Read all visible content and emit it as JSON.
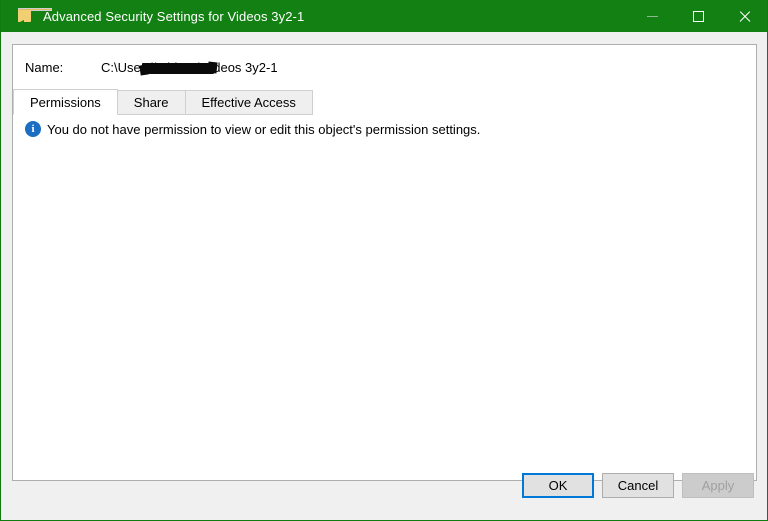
{
  "window": {
    "title": "Advanced Security Settings for Videos 3y2-1",
    "icon": "folder-shield-icon",
    "title_bar_color": "#128012",
    "controls": {
      "minimize": "minimize-icon",
      "maximize": "maximize-icon",
      "close": "close-icon"
    }
  },
  "name_row": {
    "label": "Name:",
    "value_prefix": "C:\\Users\\",
    "value_suffix": "\\Videos\\Videos 3y2-1",
    "redacted": true
  },
  "tabs": [
    {
      "label": "Permissions",
      "active": true
    },
    {
      "label": "Share",
      "active": false
    },
    {
      "label": "Effective Access",
      "active": false
    }
  ],
  "message": {
    "icon": "info-icon",
    "icon_glyph": "i",
    "icon_color": "#1b6ec2",
    "text": "You do not have permission to view or edit this object's permission settings."
  },
  "footer": {
    "buttons": [
      {
        "label": "OK",
        "state": "default"
      },
      {
        "label": "Cancel",
        "state": "normal"
      },
      {
        "label": "Apply",
        "state": "disabled"
      }
    ]
  }
}
